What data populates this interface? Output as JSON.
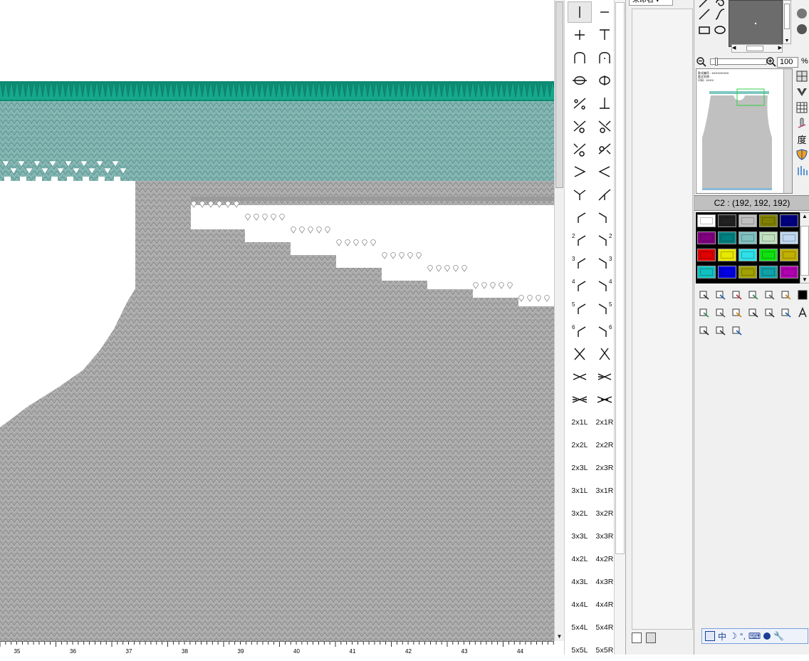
{
  "canvas": {
    "colors": {
      "gray_knit": "#aaaaaa",
      "gray_knit_dark": "#9a9a9a",
      "teal_knit": "#7fb2ae",
      "teal_bright": "#12a78c",
      "eyelet": "#ffffff"
    },
    "ruler_labels": [
      "35",
      "36",
      "37",
      "38",
      "39",
      "40",
      "41",
      "42",
      "43",
      "44"
    ]
  },
  "stitch_palette": {
    "symbol_rows": [
      [
        "vertical-bar-icon",
        "dash-icon"
      ],
      [
        "plus-icon",
        "tee-icon"
      ],
      [
        "arch-icon",
        "arch-dot-icon"
      ],
      [
        "circle-line-icon",
        "circle-line-right-icon"
      ],
      [
        "percent-icon",
        "up-tack-icon"
      ],
      [
        "slash-loop-left-icon",
        "slash-loop-right-icon"
      ],
      [
        "slash-ring-left-icon",
        "slash-ring-right-icon"
      ],
      [
        "greater-than-icon",
        "less-than-icon"
      ],
      [
        "cross-left-icon",
        "cross-right-icon"
      ],
      [
        "bend-left-icon",
        "bend-right-icon"
      ],
      [
        "bend-left-2-icon",
        "bend-right-2-icon"
      ],
      [
        "bend-left-3-icon",
        "bend-right-3-icon"
      ],
      [
        "bend-left-4-icon",
        "bend-right-4-icon"
      ],
      [
        "bend-left-5-icon",
        "bend-right-5-icon"
      ],
      [
        "bend-left-6-icon",
        "bend-right-6-icon"
      ],
      [
        "x-cross-icon",
        "x-cross-right-icon"
      ],
      [
        "double-x-icon",
        "double-x-right-icon"
      ],
      [
        "triple-x-icon",
        "triple-x-right-icon"
      ]
    ],
    "bend_numbers": [
      "2",
      "3",
      "4",
      "5",
      "6"
    ],
    "text_rows": [
      [
        "2x1L",
        "2x1R"
      ],
      [
        "2x2L",
        "2x2R"
      ],
      [
        "2x3L",
        "2x3R"
      ],
      [
        "3x1L",
        "3x1R"
      ],
      [
        "3x2L",
        "3x2R"
      ],
      [
        "3x3L",
        "3x3R"
      ],
      [
        "4x2L",
        "4x2R"
      ],
      [
        "4x3L",
        "4x3R"
      ],
      [
        "4x4L",
        "4x4R"
      ],
      [
        "5x4L",
        "5x4R"
      ],
      [
        "5x5L",
        "5x5R"
      ]
    ]
  },
  "mid_panel": {
    "dropdown_label": "未命名 ▾"
  },
  "right_panel": {
    "zoom_value": "100",
    "zoom_unit": "%",
    "thumbnail_text_lines": [
      "款式编号 : XXXXXXXXX",
      "款式名称 :",
      "尺码 : XXXX"
    ],
    "color_info": "C2 : (192, 192, 192)",
    "swatches": [
      [
        "#ffffff",
        "#222222",
        "#c0c0c0",
        "#808000",
        "#000080"
      ],
      [
        "#800080",
        "#008080",
        "#80c0c0",
        "#c0e0c0",
        "#c0d8f0"
      ],
      [
        "#e00000",
        "#e8e800",
        "#30e0e8",
        "#10e010",
        "#c0b000"
      ],
      [
        "#10c0c0",
        "#0000e0",
        "#a0a000",
        "#10a0a8",
        "#b000b0"
      ]
    ],
    "degree_label": "度",
    "language_bar": {
      "ime_label": "中",
      "moon_icon": "☽",
      "punct": "°,",
      "keyboard": "⌨"
    }
  }
}
